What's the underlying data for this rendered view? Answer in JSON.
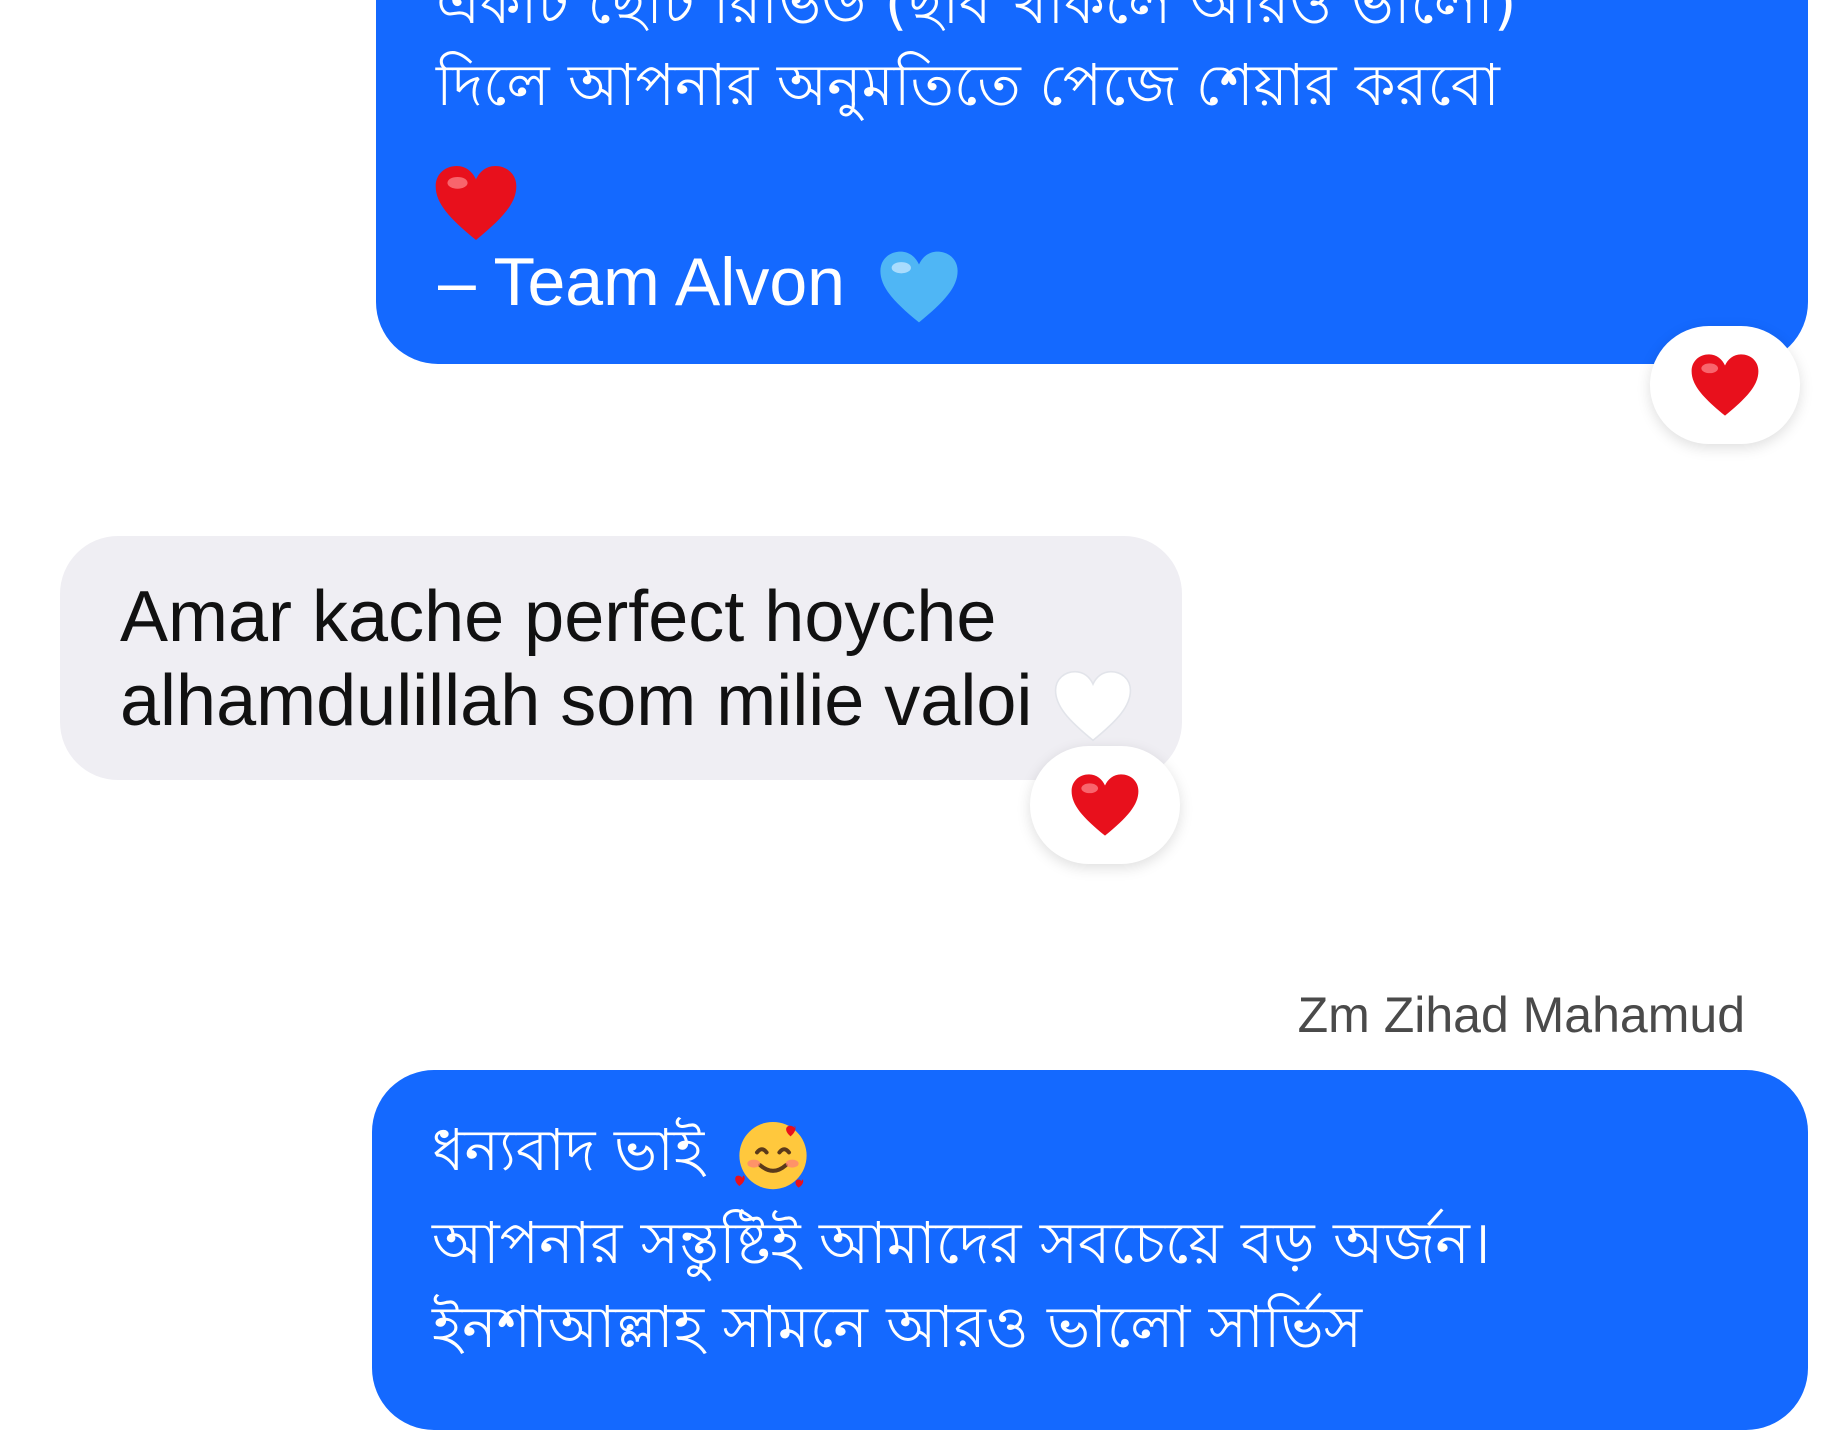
{
  "messages": [
    {
      "direction": "outgoing",
      "lines": [
        "একটি ছোট রিভিউ (ছবি থাকলে আরও ভালো)",
        "দিলে আপনার অনুমতিতে পেজে শেয়ার করবো",
        "– Team Alvon"
      ],
      "emojis": [
        "red-heart",
        "light-blue-heart"
      ],
      "reaction": "red-heart"
    },
    {
      "direction": "incoming",
      "lines": [
        "Amar kache perfect hoyche",
        "alhamdulillah som milie valoi"
      ],
      "emojis": [
        "white-heart"
      ],
      "reaction": "red-heart"
    },
    {
      "direction": "outgoing",
      "sender": "Zm Zihad Mahamud",
      "lines": [
        "ধন্যবাদ ভাই",
        "আপনার সন্তুষ্টিই আমাদের সবচেয়ে বড় অর্জন।",
        "ইনশাআল্লাহ সামনে আরও ভালো সার্ভিস"
      ],
      "emojis": [
        "smiling-face-with-hearts"
      ]
    }
  ],
  "colors": {
    "outgoing_bubble": "#1469ff",
    "incoming_bubble": "#efeef3",
    "heart_red": "#e8101c",
    "heart_light_blue": "#4fb6f5"
  }
}
